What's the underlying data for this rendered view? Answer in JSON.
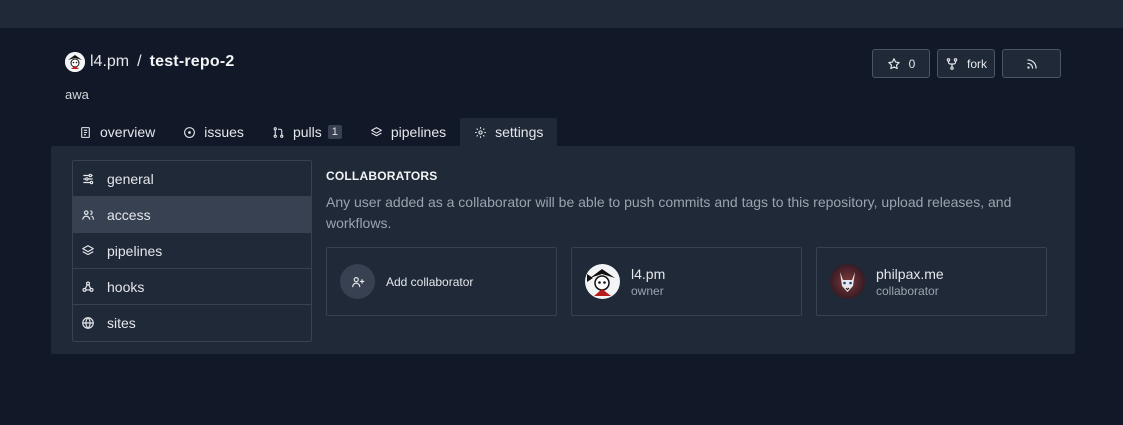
{
  "repo": {
    "owner": "l4.pm",
    "separator": "/",
    "name": "test-repo-2",
    "description": "awa"
  },
  "actions": {
    "star_icon": "star-icon",
    "star_count": "0",
    "fork_icon": "fork-icon",
    "fork_label": "fork",
    "rss_icon": "rss-icon"
  },
  "tabs": [
    {
      "label": "overview",
      "icon": "book-icon"
    },
    {
      "label": "issues",
      "icon": "circle-dot-icon"
    },
    {
      "label": "pulls",
      "icon": "git-pull-request-icon",
      "count": "1"
    },
    {
      "label": "pipelines",
      "icon": "layers-icon"
    },
    {
      "label": "settings",
      "icon": "gear-icon",
      "active": true
    }
  ],
  "settings_menu": [
    {
      "label": "general",
      "icon": "sliders-icon"
    },
    {
      "label": "access",
      "icon": "users-icon",
      "active": true
    },
    {
      "label": "pipelines",
      "icon": "layers-icon"
    },
    {
      "label": "hooks",
      "icon": "webhook-icon"
    },
    {
      "label": "sites",
      "icon": "globe-icon"
    }
  ],
  "collaborators_section": {
    "title": "COLLABORATORS",
    "description": "Any user added as a collaborator will be able to push commits and tags to this repository, upload releases, and workflows.",
    "add_label": "Add collaborator",
    "add_icon": "user-plus-icon",
    "members": [
      {
        "name": "l4.pm",
        "role": "owner"
      },
      {
        "name": "philpax.me",
        "role": "collaborator"
      }
    ]
  },
  "colors": {
    "page_bg": "#111827",
    "surface": "#1f2937",
    "border": "#374151",
    "muted_text": "#9ca3af"
  }
}
